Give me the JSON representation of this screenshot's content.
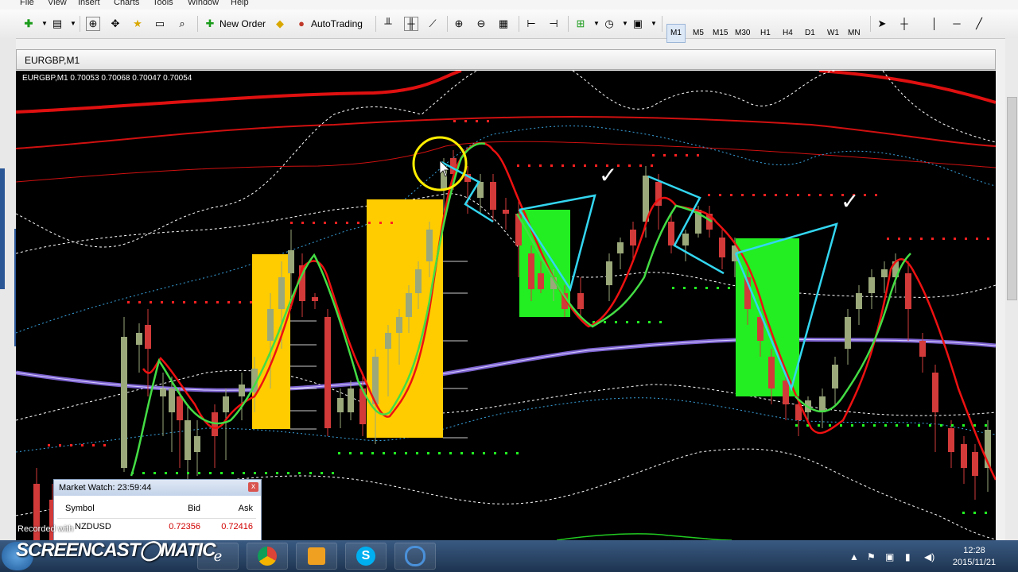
{
  "menu": [
    "File",
    "View",
    "Insert",
    "Charts",
    "Tools",
    "Window",
    "Help"
  ],
  "toolbar": {
    "new_order": "New Order",
    "autotrading": "AutoTrading",
    "timeframes": [
      "M1",
      "M5",
      "M15",
      "M30",
      "H1",
      "H4",
      "D1",
      "W1",
      "MN"
    ]
  },
  "chart_window": {
    "title": "EURGBP,M1",
    "info": "EURGBP,M1  0.70053 0.70068 0.70047 0.70054",
    "checkmarks": [
      "✓",
      "✓"
    ]
  },
  "market_watch": {
    "title": "Market Watch: 23:59:44",
    "close": "x",
    "headers": {
      "symbol": "Symbol",
      "bid": "Bid",
      "ask": "Ask"
    },
    "rows": [
      {
        "symbol": "NZDUSD",
        "bid": "0.72356",
        "ask": "0.72416"
      }
    ]
  },
  "overlay": {
    "recorded": "Recorded with",
    "brand": "SCREENCAST◯MATIC"
  },
  "taskbar": {
    "time": "12:28",
    "date": "2015/11/21"
  },
  "colors": {
    "chart_bg": "#000000",
    "bull": "#9aa87a",
    "bear": "#d23a3a",
    "yellow_box": "#ffcc00",
    "green_box": "#22ee22",
    "cyan": "#33d6f0",
    "purple": "#8a6ee6"
  }
}
